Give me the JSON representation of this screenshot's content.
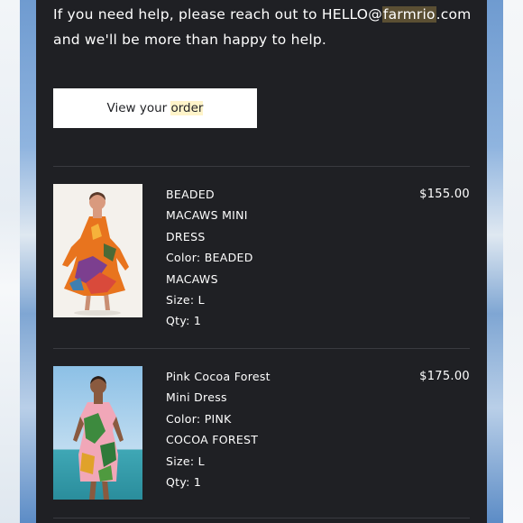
{
  "email": {
    "help_text_before": "If you need help, please reach out to HELLO@",
    "help_domain_hl": "farmrio",
    "help_text_after": ".com and we'll be more than happy to help.",
    "view_order_prefix": "View your",
    "view_order_hl": "order"
  },
  "items": [
    {
      "name_lines": [
        "BEADED",
        "MACAWS MINI",
        "DRESS"
      ],
      "color_lines": [
        "Color: BEADED",
        "MACAWS"
      ],
      "size": "Size: L",
      "qty": "Qty: 1",
      "price": "$155.00"
    },
    {
      "name_lines": [
        "Pink Cocoa Forest",
        "Mini Dress"
      ],
      "color_lines": [
        "Color: PINK",
        "COCOA FOREST"
      ],
      "size": "Size: L",
      "qty": "Qty: 1",
      "price": "$175.00"
    }
  ]
}
